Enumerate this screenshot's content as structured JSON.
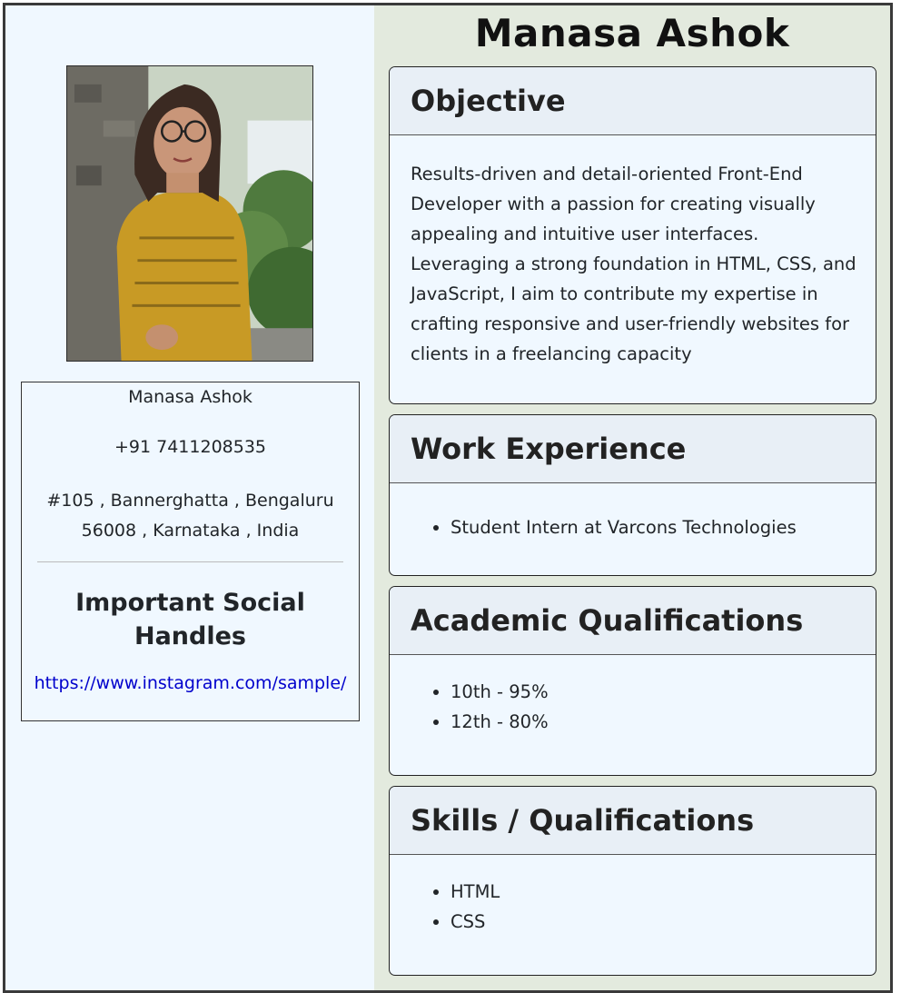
{
  "name": "Manasa Ashok",
  "contact": {
    "name": "Manasa Ashok",
    "phone": "+91 7411208535",
    "address": "#105 , Bannerghatta , Bengaluru 56008 , Karnataka , India",
    "social_heading": "Important Social Handles",
    "instagram": "https://www.instagram.com/sample/"
  },
  "sections": {
    "objective": {
      "title": "Objective",
      "text": "Results-driven and detail-oriented Front-End Developer with a passion for creating visually appealing and intuitive user interfaces. Leveraging a strong foundation in HTML, CSS, and JavaScript, I aim to contribute my expertise in crafting responsive and user-friendly websites for clients in a freelancing capacity"
    },
    "work": {
      "title": "Work Experience",
      "items": [
        "Student Intern at Varcons Technologies"
      ]
    },
    "academic": {
      "title": "Academic Qualifications",
      "items": [
        "10th - 95%",
        "12th - 80%"
      ]
    },
    "skills": {
      "title": "Skills / Qualifications",
      "items": [
        "HTML",
        "CSS"
      ]
    }
  },
  "colors": {
    "left_bg": "#f0f8ff",
    "right_bg": "#e3eade",
    "card_header_bg": "#e8eff6",
    "link": "#0000cc"
  }
}
